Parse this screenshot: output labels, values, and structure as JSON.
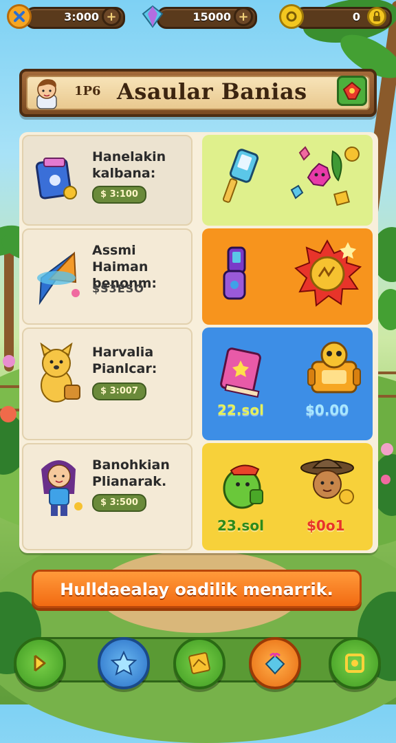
{
  "resources": [
    {
      "name": "close",
      "value": "3:000",
      "icon": "x-icon"
    },
    {
      "name": "gems",
      "value": "15000",
      "icon": "gem-icon"
    },
    {
      "name": "coins",
      "value": "0",
      "icon": "coin-icon"
    }
  ],
  "banner": {
    "rank": "1P6",
    "title": "Asaular Banias"
  },
  "cards": [
    {
      "name": "Hanelakin kalbana:",
      "price": "$ 3:100",
      "icon": "tablet-icon"
    },
    {
      "name": "Assmi Haiman benonm:",
      "price": "$S3ESO",
      "icon": "paper-plane-icon"
    },
    {
      "name": "Harvalia Pianlcar:",
      "price": "$ 3:007",
      "icon": "dog-icon"
    },
    {
      "name": "Banohkian Plianarak.",
      "price": "$ 3:500",
      "icon": "girl-icon"
    }
  ],
  "tiles": [
    {
      "color": "#dff08c",
      "icons": [
        "phone-tool-icon",
        "crystal-flower-icon"
      ],
      "labels": []
    },
    {
      "color": "#f7941d",
      "icons": [
        "walkie-talkie-icon",
        "sun-badge-icon"
      ],
      "labels": []
    },
    {
      "color": "#3d8ee6",
      "icons": [
        "book-icon",
        "robot-icon"
      ],
      "labels": [
        "22.sol",
        "$0.00"
      ]
    },
    {
      "color": "#f7d13a",
      "icons": [
        "green-creature-icon",
        "adventurer-icon"
      ],
      "labels": [
        "23.sol",
        "$0o1"
      ]
    }
  ],
  "cta": {
    "label": "Hulldaealay oadilik menarrik."
  },
  "nav": [
    {
      "icon": "back-arrow-icon"
    },
    {
      "icon": "star-icon"
    },
    {
      "icon": "map-icon"
    },
    {
      "icon": "gift-icon"
    },
    {
      "icon": "settings-icon"
    }
  ],
  "colors": {
    "accent": "#f26a12",
    "wood": "#7a4a22",
    "panel": "#f8efdb"
  }
}
